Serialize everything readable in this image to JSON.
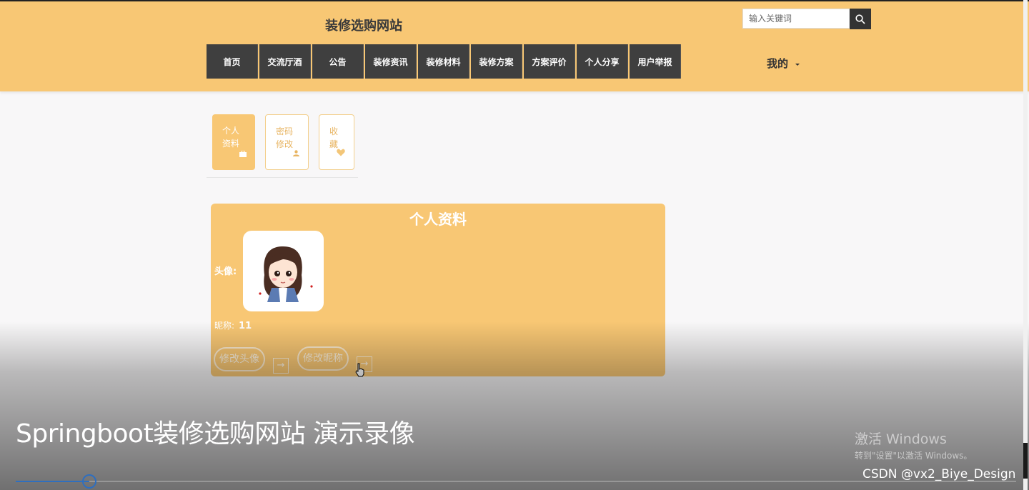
{
  "header": {
    "site_title": "装修选购网站",
    "search": {
      "placeholder": "输入关键词"
    },
    "nav": [
      "首页",
      "交流厅酒",
      "公告",
      "装修资讯",
      "装修材料",
      "装修方案",
      "方案评价",
      "个人分享",
      "用户举报"
    ],
    "my_menu": "我的"
  },
  "tabs": [
    {
      "line1": "个人",
      "line2": "资料",
      "icon": "briefcase-icon",
      "active": true
    },
    {
      "line1": "密码",
      "line2": "修改",
      "icon": "user-icon",
      "active": false
    },
    {
      "line1": "收",
      "line2": "藏",
      "icon": "heart-icon",
      "active": false
    }
  ],
  "profile": {
    "title": "个人资料",
    "avatar_label": "头像:",
    "nickname_label": "昵称:",
    "nickname_value": "11",
    "change_avatar": "修改头像",
    "change_nickname": "修改昵称"
  },
  "overlay": {
    "video_title": "Springboot装修选购网站 演示录像",
    "watermark_line1": "激活 Windows",
    "watermark_line2": "转到\"设置\"以激活 Windows。",
    "csdn": "CSDN @vx2_Biye_Design",
    "progress": 0.073
  },
  "colors": {
    "accent": "#f8c774",
    "nav_bg": "#3f3f3f",
    "progress": "#2f6fbf"
  }
}
